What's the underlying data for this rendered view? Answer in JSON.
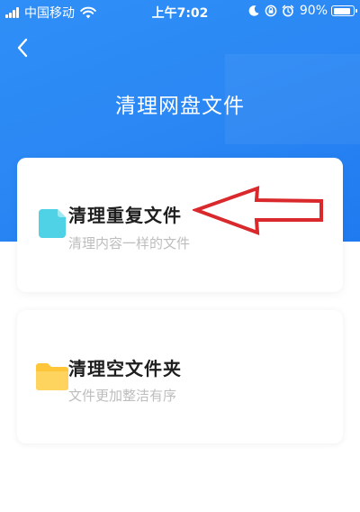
{
  "status_bar": {
    "carrier": "中国移动",
    "time": "上午7:02",
    "battery_percent": "90%",
    "battery_level": 0.9,
    "icons": [
      "signal-icon",
      "wifi-icon",
      "moon-icon",
      "orientation-lock-icon",
      "alarm-icon",
      "battery-icon"
    ]
  },
  "header": {
    "back_icon": "chevron-left-icon",
    "title": "清理网盘文件"
  },
  "options": [
    {
      "icon": "document-icon",
      "title": "清理重复文件",
      "subtitle": "清理内容一样的文件"
    },
    {
      "icon": "folder-icon",
      "title": "清理空文件夹",
      "subtitle": "文件更加整洁有序"
    }
  ],
  "colors": {
    "header_blue": "#2a86f3",
    "doc_icon": "#4fd2e6",
    "folder_icon": "#ffc63a",
    "annotation_arrow": "#d9292c"
  }
}
